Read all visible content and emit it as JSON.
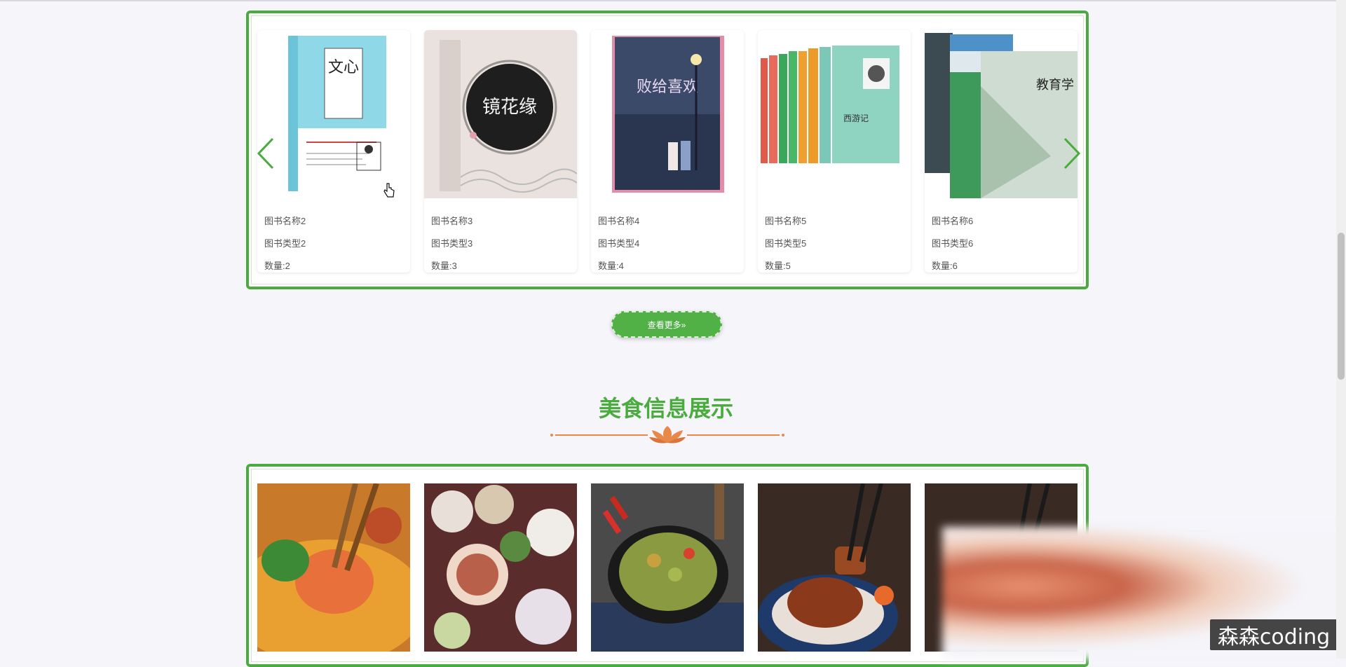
{
  "books_carousel": {
    "items": [
      {
        "name": "图书名称2",
        "type": "图书类型2",
        "count": "数量:2",
        "cover_text": "文心"
      },
      {
        "name": "图书名称3",
        "type": "图书类型3",
        "count": "数量:3",
        "cover_text": "镜花缘"
      },
      {
        "name": "图书名称4",
        "type": "图书类型4",
        "count": "数量:4",
        "cover_text": "败给喜欢"
      },
      {
        "name": "图书名称5",
        "type": "图书类型5",
        "count": "数量:5",
        "cover_text": "西游记"
      },
      {
        "name": "图书名称6",
        "type": "图书类型6",
        "count": "数量:6",
        "cover_text": "教育学"
      }
    ],
    "prev_icon": "chevron-left-icon",
    "next_icon": "chevron-right-icon"
  },
  "more_button": {
    "label": "查看更多»"
  },
  "food_section": {
    "title": "美食信息展示"
  },
  "watermark": {
    "text": "森森coding"
  },
  "colors": {
    "accent": "#4aab3e",
    "divider": "#e8894a",
    "background": "#f5f5fa"
  }
}
